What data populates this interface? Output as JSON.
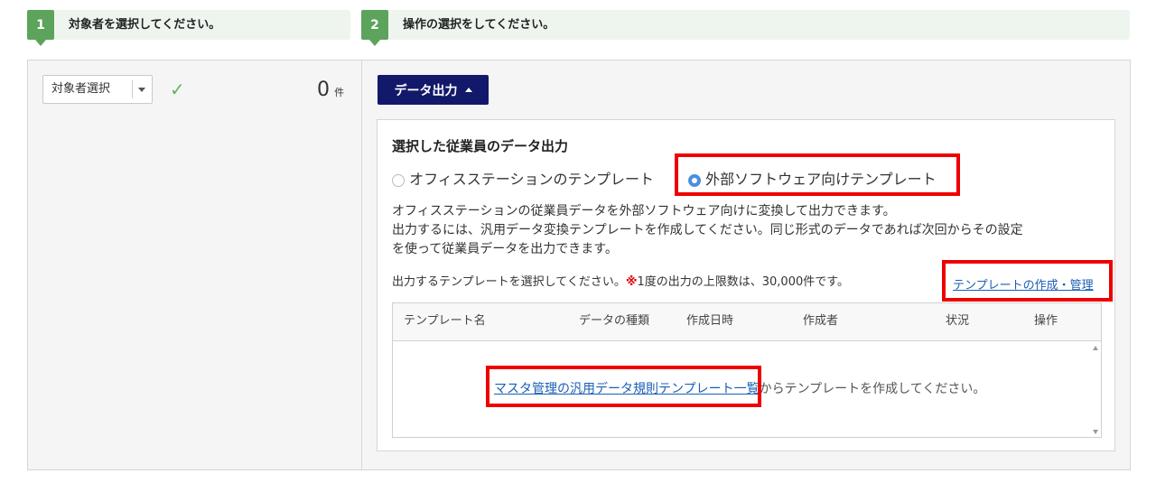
{
  "steps": [
    {
      "number": "1",
      "label": "対象者を選択してください。"
    },
    {
      "number": "2",
      "label": "操作の選択をしてください。"
    }
  ],
  "left_panel": {
    "select_value": "対象者選択",
    "count": "0",
    "count_unit": "件"
  },
  "right_panel": {
    "export_button": "データ出力",
    "section_title": "選択した従業員のデータ出力",
    "radio_options": [
      {
        "label": "オフィスステーションのテンプレート",
        "selected": false
      },
      {
        "label": "外部ソフトウェア向けテンプレート",
        "selected": true
      }
    ],
    "description_lines": [
      "オフィスステーションの従業員データを外部ソフトウェア向けに変換して出力できます。",
      "出力するには、汎用データ変換テンプレートを作成してください。同じ形式のデータであれば次回からその設定",
      "を使って従業員データを出力できます。"
    ],
    "select_prompt": "出力するテンプレートを選択してください。",
    "limit_mark": "※",
    "limit_text": "1度の出力の上限数は、30,000件です。",
    "manage_link": "テンプレートの作成・管理",
    "table": {
      "columns": [
        "テンプレート名",
        "データの種類",
        "作成日時",
        "作成者",
        "状況",
        "操作"
      ],
      "rows": [],
      "empty_link": "マスタ管理の汎用データ規則テンプレート一覧",
      "empty_text": "からテンプレートを作成してください。"
    }
  },
  "colors": {
    "step_green": "#5ca35c",
    "button_navy": "#12186a",
    "highlight_red": "#ef0000",
    "link_blue": "#1a5fb4",
    "radio_blue": "#4a8fe0"
  }
}
